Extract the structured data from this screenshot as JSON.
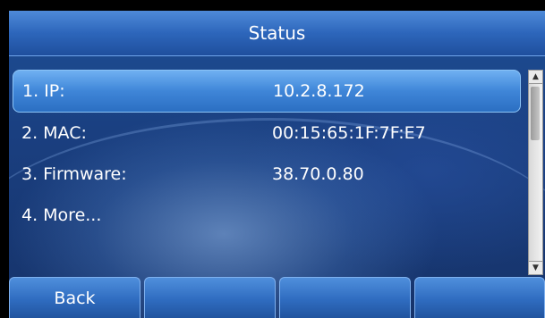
{
  "title": "Status",
  "items": [
    {
      "label": "1. IP:",
      "value": "10.2.8.172"
    },
    {
      "label": "2. MAC:",
      "value": "00:15:65:1F:7F:E7"
    },
    {
      "label": "3. Firmware:",
      "value": "38.70.0.80"
    },
    {
      "label": "4. More...",
      "value": ""
    }
  ],
  "selected_index": 0,
  "softkeys": [
    "Back",
    "",
    "",
    ""
  ],
  "scrollbar": {
    "up_icon": "triangle-up",
    "down_icon": "triangle-down"
  }
}
